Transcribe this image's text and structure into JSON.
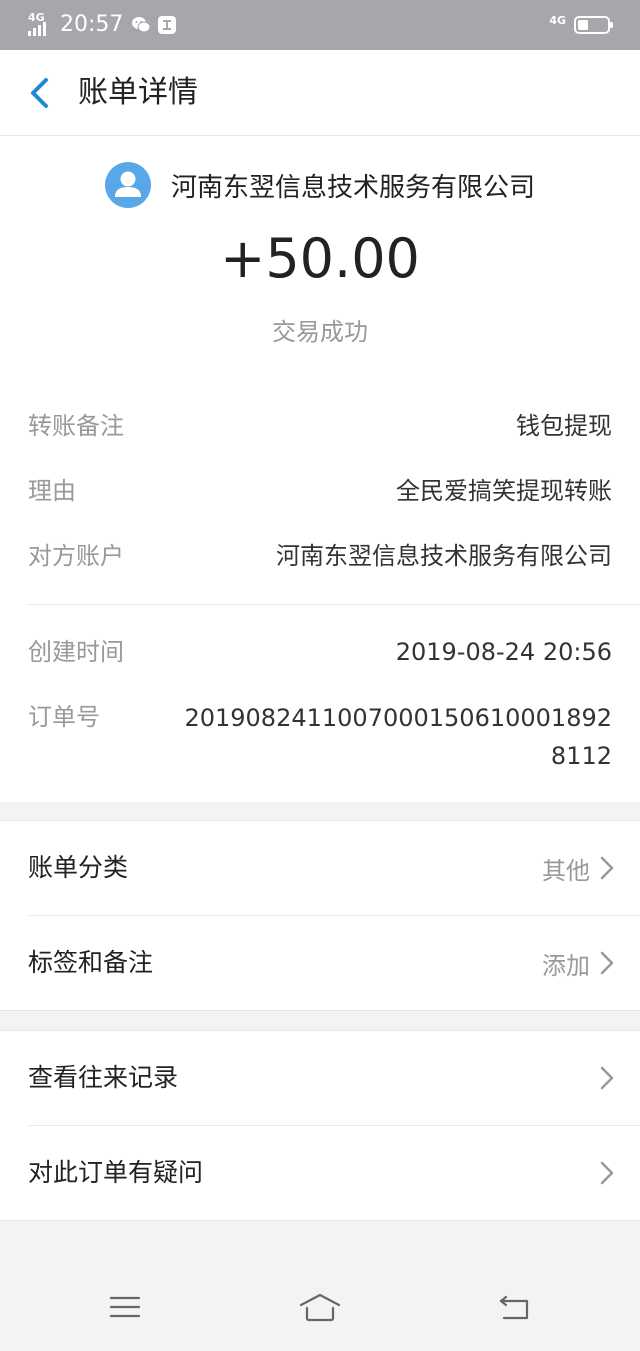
{
  "status_bar": {
    "network_left": "4G",
    "time": "20:57",
    "network_right": "4G",
    "icons": [
      "signal-icon",
      "wechat-icon",
      "app-notification-icon",
      "battery-icon"
    ]
  },
  "header": {
    "title": "账单详情"
  },
  "detail": {
    "party_name": "河南东翌信息技术服务有限公司",
    "amount": "+50.00",
    "status": "交易成功",
    "rows": [
      {
        "label": "转账备注",
        "value": "钱包提现"
      },
      {
        "label": "理由",
        "value": "全民爱搞笑提现转账"
      },
      {
        "label": "对方账户",
        "value": "河南东翌信息技术服务有限公司"
      },
      {
        "label": "创建时间",
        "value": "2019-08-24 20:56"
      },
      {
        "label": "订单号",
        "value": "2019082411007000150610001892 8112"
      }
    ]
  },
  "options_group_1": [
    {
      "label": "账单分类",
      "value": "其他"
    },
    {
      "label": "标签和备注",
      "value": "添加"
    }
  ],
  "options_group_2": [
    {
      "label": "查看往来记录",
      "value": ""
    },
    {
      "label": "对此订单有疑问",
      "value": ""
    }
  ],
  "colors": {
    "accent": "#1e88d2",
    "avatar": "#5aa7e8",
    "status_bar": "#a6a6ab",
    "muted_text": "#999999",
    "background": "#f3f3f5"
  }
}
